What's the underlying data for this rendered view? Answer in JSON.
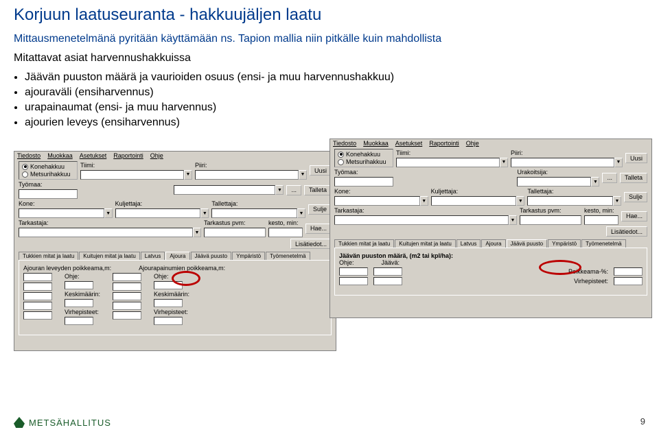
{
  "title": "Korjuun laatuseuranta - hakkuujäljen laatu",
  "subtitle": "Mittausmenetelmänä pyritään käyttämään ns. Tapion mallia niin pitkälle kuin mahdollista",
  "paragraph": "Mitattavat asiat harvennushakkuissa",
  "bullets": [
    "Jäävän puuston määrä  ja vaurioiden osuus (ensi- ja muu harvennushakkuu)",
    "ajouraväli (ensiharvennus)",
    "urapainaumat (ensi- ja muu harvennus)",
    "ajourien leveys (ensiharvennus)"
  ],
  "menu": {
    "items": [
      "Tiedosto",
      "Muokkaa",
      "Asetukset",
      "Raportointi",
      "Ohje"
    ]
  },
  "radios": {
    "option1": "Konehakkuu",
    "option2": "Metsurihakkuu"
  },
  "labels": {
    "tiimi": "Tiimi:",
    "piiri": "Piiri:",
    "tyomaa": "Työmaa:",
    "kone": "Kone:",
    "kuljettaja": "Kuljettaja:",
    "tallettaja": "Tallettaja:",
    "tarkastaja": "Tarkastaja:",
    "tarkastuspvm": "Tarkastus pvm:",
    "kesto": "kesto, min:",
    "urakoitsija": "Urakoitsija:",
    "ohje": "Ohje:",
    "keskimaarin": "Keskimäärin:",
    "virhepisteet": "Virhepisteet:",
    "poikkeama": "Poikkeama-%:",
    "jaava": "Jäävä:",
    "ajoleveys": "Ajouran leveyden poikkeama,m:",
    "ajopainuma": "Ajourapainumien poikkeama,m:"
  },
  "buttons": {
    "uusi": "Uusi",
    "talleta": "Talleta",
    "sulje": "Sulje",
    "hae": "Hae...",
    "lisatiedot": "Lisätiedot...",
    "dots": "..."
  },
  "tabs_common": [
    "Tukkien mitat ja laatu",
    "Kuitujen mitat ja laatu",
    "Latvus",
    "Ajoura",
    "Jäävä puusto",
    "Ympäristö",
    "Työmenetelmä"
  ],
  "panel1_title": "",
  "panel2_title": "Jäävän puuston määrä, (m2 tai kpl/ha):",
  "brand": "METSÄHALLITUS",
  "pagenum": "9"
}
